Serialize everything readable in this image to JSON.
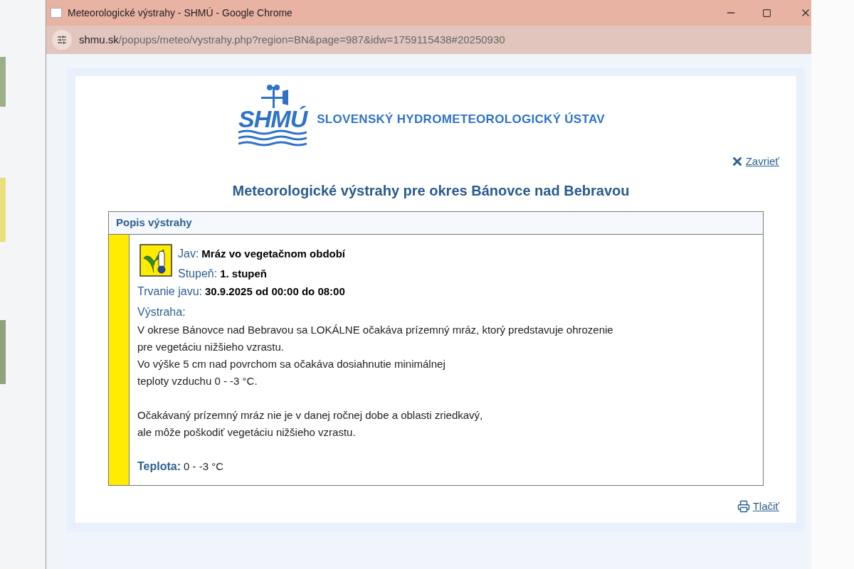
{
  "window": {
    "title": "Meteorologické výstrahy - SHMÚ - Google Chrome",
    "url_host": "shmu.sk",
    "url_path": "/popups/meteo/vystrahy.php?region=BN&page=987&idw=1759115438#20250930"
  },
  "header": {
    "logo_text": "SHMÚ",
    "org_name": "SLOVENSKÝ HYDROMETEOROLOGICKÝ ÚSTAV"
  },
  "close_link": "Zavrieť",
  "heading": "Meteorologické výstrahy pre okres Bánovce nad Bebravou",
  "warning": {
    "panel_title": "Popis výstrahy",
    "color": "#ffec00",
    "fields": [
      {
        "label": "Jav:",
        "value": "Mráz vo vegetačnom období"
      },
      {
        "label": "Stupeň:",
        "value": "1. stupeň"
      },
      {
        "label": "Trvanie javu:",
        "value": "30.9.2025 od 00:00 do 08:00"
      }
    ],
    "text_label": "Výstraha:",
    "paragraphs": [
      [
        "V okrese Bánovce nad Bebravou sa LOKÁLNE očakáva prízemný mráz, ktorý predstavuje ohrozenie",
        "pre vegetáciu nižšieho vzrastu.",
        "Vo výške 5 cm nad povrchom sa očakáva dosiahnutie minimálnej",
        "teploty vzduchu 0 - -3 °C."
      ],
      [
        "Očakávaný prízemný mráz nie je v danej ročnej dobe a oblasti zriedkavý,",
        "ale môže poškodiť vegetáciu nižšieho vzrastu."
      ]
    ],
    "temperature": {
      "label": "Teplota:",
      "value": "0 - -3 °C"
    }
  },
  "print_link": "Tlačiť"
}
